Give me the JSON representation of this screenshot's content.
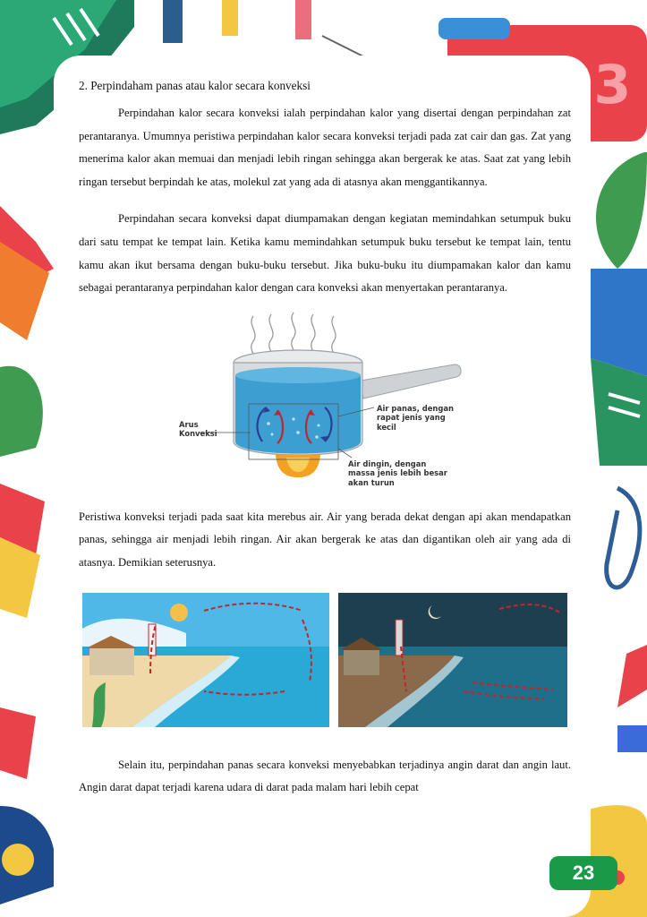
{
  "heading": "2. Perpindaham panas atau kalor secara konveksi",
  "paragraphs": {
    "p1": "Perpindahan kalor secara konveksi ialah perpindahan kalor yang disertai dengan perpindahan zat perantaranya. Umumnya peristiwa perpindahan kalor secara konveksi terjadi pada zat cair dan gas. Zat yang menerima kalor akan memuai dan menjadi lebih ringan sehingga akan bergerak ke atas. Saat zat yang lebih ringan tersebut berpindah ke atas, molekul zat yang ada di atasnya akan menggantikannya.",
    "p2": "Perpindahan secara konveksi dapat diumpamakan dengan kegiatan memindahkan setumpuk buku dari satu tempat ke tempat lain. Ketika kamu memindahkan setumpuk buku tersebut ke tempat lain, tentu kamu akan ikut bersama dengan buku-buku tersebut. Jika buku-buku itu diumpamakan kalor dan kamu sebagai perantaranya perpindahan kalor dengan cara konveksi akan menyertakan perantaranya.",
    "p3": "Peristiwa konveksi terjadi pada saat kita merebus air. Air yang berada dekat dengan api akan mendapatkan panas, sehingga air menjadi lebih ringan. Air akan bergerak ke atas dan digantikan oleh air yang ada di atasnya. Demikian seterusnya.",
    "p4": "Selain itu, perpindahan panas secara konveksi menyebabkan terjadinya angin darat dan angin laut. Angin darat dapat terjadi karena udara di darat pada malam hari lebih cepat"
  },
  "figure_pot": {
    "label_arus_line1": "Arus",
    "label_arus_line2": "Konveksi",
    "label_hot_line1": "Air panas, dengan",
    "label_hot_line2": "rapat jenis yang",
    "label_hot_line3": "kecil",
    "label_cold_line1": "Air dingin, dengan",
    "label_cold_line2": "massa jenis lebih besar",
    "label_cold_line3": "akan turun"
  },
  "page_number": "23",
  "colors": {
    "accent_green": "#1a9a48",
    "water_blue": "#3d9fd1",
    "arrow_red": "#c0272d",
    "sea": "#29a9d6",
    "night_sky": "#1d3f4f"
  }
}
